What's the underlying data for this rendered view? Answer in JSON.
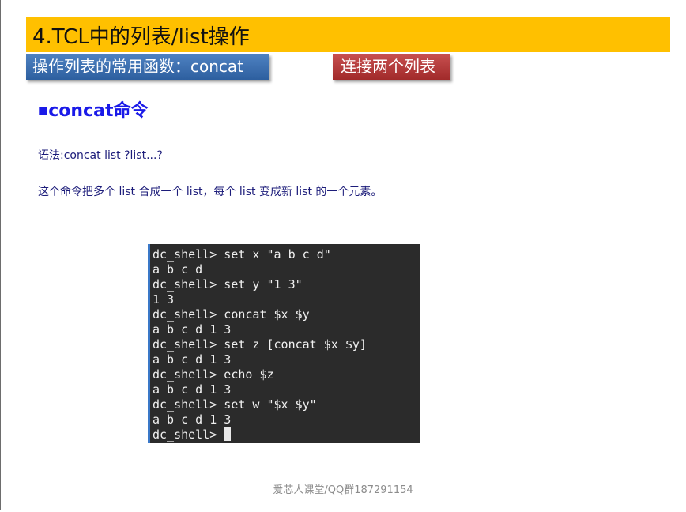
{
  "slide": {
    "title": "4.TCL中的列表/list操作",
    "subtitle_left": "操作列表的常用函数：concat",
    "subtitle_right": "连接两个列表",
    "section": {
      "bullet": "■",
      "heading": "concat命令"
    },
    "syntax": "语法:concat list ?list...?",
    "description": "这个命令把多个 list 合成一个 list，每个 list 变成新 list 的一个元素。",
    "footer": "爱芯人课堂/QQ群187291154"
  },
  "terminal": {
    "lines": [
      "dc_shell> set x \"a b c d\"",
      "a b c d",
      "dc_shell> set y \"1 3\"",
      "1 3",
      "dc_shell> concat $x $y",
      "a b c d 1 3",
      "dc_shell> set z [concat $x $y]",
      "a b c d 1 3",
      "dc_shell> echo $z",
      "a b c d 1 3",
      "dc_shell> set w \"$x $y\"",
      "a b c d 1 3",
      "dc_shell> "
    ]
  },
  "colors": {
    "title_bar": "#ffc000",
    "subtitle_left_bg": "#3a6fb0",
    "subtitle_right_bg": "#b33a3a",
    "heading": "#1a1ae8",
    "body_text": "#1c1c7a",
    "terminal_bg": "#2b2b2b"
  }
}
